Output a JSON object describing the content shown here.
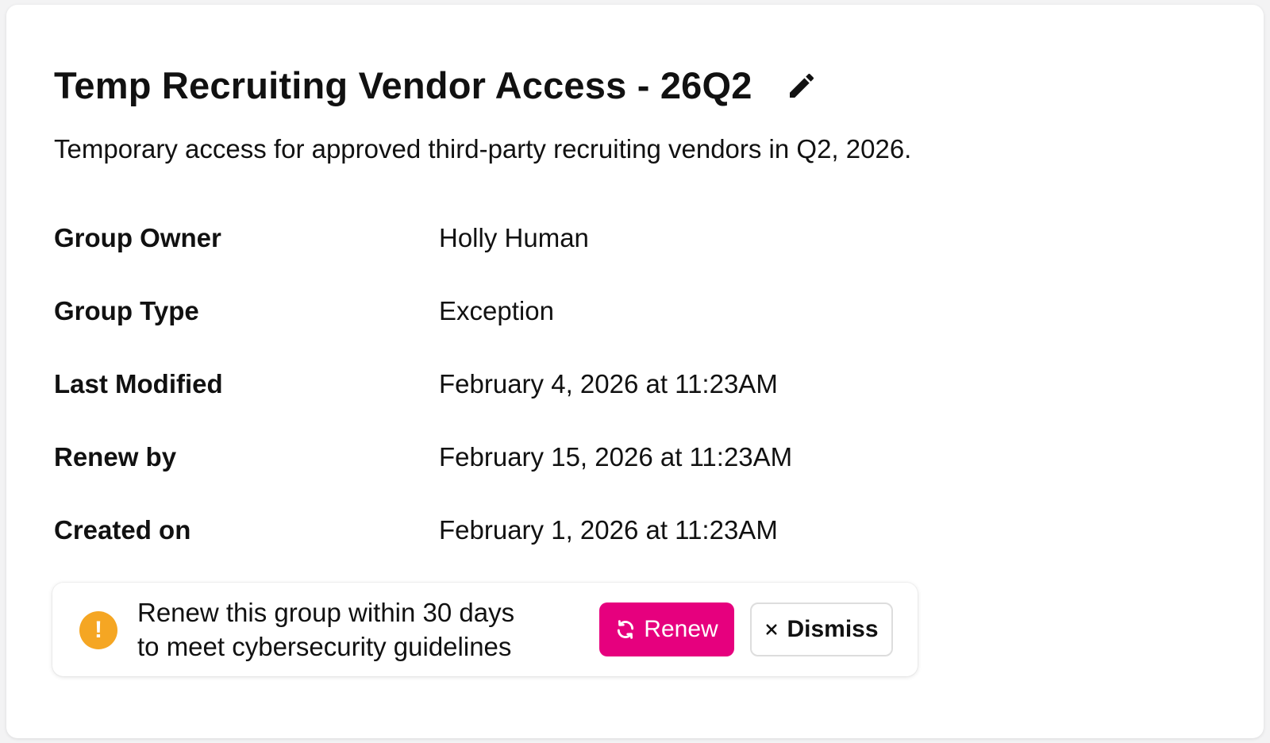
{
  "group": {
    "title": "Temp Recruiting Vendor Access - 26Q2",
    "description": "Temporary access for approved third-party recruiting vendors in Q2, 2026."
  },
  "details": {
    "owner": {
      "label": "Group Owner",
      "value": "Holly Human"
    },
    "type": {
      "label": "Group Type",
      "value": "Exception"
    },
    "last_modified": {
      "label": "Last Modified",
      "value": "February 4, 2026 at 11:23AM"
    },
    "renew_by": {
      "label": "Renew by",
      "value": "February 15, 2026 at 11:23AM"
    },
    "created_on": {
      "label": "Created on",
      "value": "February 1, 2026 at 11:23AM"
    }
  },
  "notice": {
    "icon": "warning-icon",
    "icon_glyph": "!",
    "line1": "Renew this group within 30 days",
    "line2": "to meet cybersecurity guidelines",
    "renew_label": "Renew",
    "dismiss_label": "Dismiss"
  },
  "icons": {
    "edit": "pencil-icon",
    "renew": "refresh-icon",
    "dismiss": "close-icon"
  },
  "colors": {
    "accent": "#e6007e",
    "warning": "#f5a623",
    "text": "#111111"
  }
}
